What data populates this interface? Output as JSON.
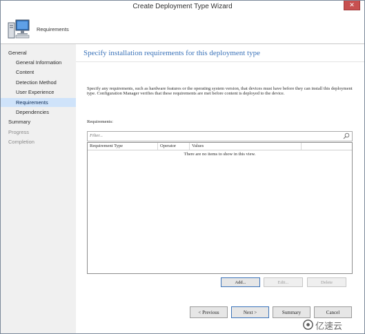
{
  "window": {
    "title": "Create Deployment Type Wizard",
    "close_glyph": "✕"
  },
  "header": {
    "title": "Requirements"
  },
  "sidebar": {
    "items": [
      {
        "label": "General",
        "level": 1,
        "state": "normal"
      },
      {
        "label": "General Information",
        "level": 2,
        "state": "normal"
      },
      {
        "label": "Content",
        "level": 2,
        "state": "normal"
      },
      {
        "label": "Detection Method",
        "level": 2,
        "state": "normal"
      },
      {
        "label": "User Experience",
        "level": 2,
        "state": "normal"
      },
      {
        "label": "Requirements",
        "level": 2,
        "state": "active"
      },
      {
        "label": "Dependencies",
        "level": 2,
        "state": "normal"
      },
      {
        "label": "Summary",
        "level": 1,
        "state": "normal"
      },
      {
        "label": "Progress",
        "level": 1,
        "state": "disabled"
      },
      {
        "label": "Completion",
        "level": 1,
        "state": "disabled"
      }
    ]
  },
  "main": {
    "title": "Specify installation requirements for this deployment type",
    "description": "Specify any requirements, such as hardware features or the operating system version, that devices must have before they can install this deployment type. Configuration Manager verifies that these requirements are met before content is deployed to the device.",
    "requirements_label": "Requirements:",
    "filter_placeholder": "Filter...",
    "columns": [
      "Requirement Type",
      "Operator",
      "Values"
    ],
    "empty_message": "There are no items to show in this view.",
    "buttons": {
      "add": "Add...",
      "edit": "Edit...",
      "delete": "Delete"
    }
  },
  "footer": {
    "previous": "< Previous",
    "next": "Next >",
    "summary": "Summary",
    "cancel": "Cancel"
  },
  "watermark": {
    "text": "亿速云"
  },
  "colors": {
    "accent_title": "#3b73b9",
    "active_item": "#cfe3fa",
    "close": "#c75050"
  },
  "icons": {
    "header": "computer-icon",
    "filter": "search-icon",
    "watermark": "cloud-logo-icon"
  }
}
